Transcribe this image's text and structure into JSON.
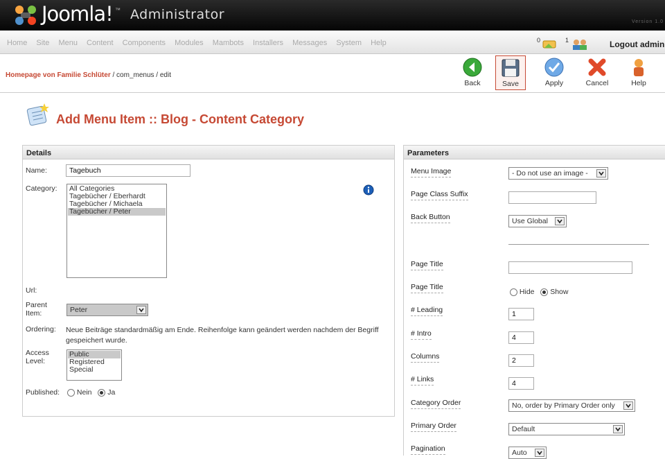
{
  "header": {
    "logo_word": "Joomla!",
    "logo_tm": "™",
    "logo_admin": "Administrator",
    "version": "Version 1.0"
  },
  "mainmenu": [
    "Home",
    "Site",
    "Menu",
    "Content",
    "Components",
    "Modules",
    "Mambots",
    "Installers",
    "Messages",
    "System",
    "Help"
  ],
  "status": {
    "messages_count": "0",
    "users_count": "1",
    "logout": "Logout admin"
  },
  "breadcrumb": {
    "home": "Homepage von Familie Schlüter",
    "path": " / com_menus / edit"
  },
  "toolbar": {
    "back": "Back",
    "save": "Save",
    "apply": "Apply",
    "cancel": "Cancel",
    "help": "Help"
  },
  "page": {
    "title": "Add Menu Item :: Blog - Content Category"
  },
  "details": {
    "heading": "Details",
    "name_label": "Name:",
    "name_value": "Tagebuch",
    "category_label": "Category:",
    "categories": [
      "All Categories",
      "Tagebücher / Eberhardt",
      "Tagebücher / Michaela",
      "Tagebücher / Peter"
    ],
    "url_label": "Url:",
    "parent_label": "Parent Item:",
    "parent_value": "Peter",
    "ordering_label": "Ordering:",
    "ordering_text": "Neue Beiträge standardmäßig am Ende. Reihenfolge kann geändert werden nachdem der Begriff gespeichert wurde.",
    "access_label": "Access Level:",
    "access_levels": [
      "Public",
      "Registered",
      "Special"
    ],
    "published_label": "Published:",
    "published_no": "Nein",
    "published_yes": "Ja"
  },
  "parameters": {
    "heading": "Parameters",
    "menu_image_label": "Menu Image",
    "menu_image_value": "- Do not use an image -",
    "page_class_label": "Page Class Suffix",
    "back_button_label": "Back Button",
    "back_button_value": "Use Global",
    "page_title_label": "Page Title",
    "page_title_label2": "Page Title",
    "hide": "Hide",
    "show": "Show",
    "leading_label": "# Leading",
    "leading_value": "1",
    "intro_label": "# Intro",
    "intro_value": "4",
    "columns_label": "Columns",
    "columns_value": "2",
    "links_label": "# Links",
    "links_value": "4",
    "category_order_label": "Category Order",
    "category_order_value": "No, order by Primary Order only",
    "primary_order_label": "Primary Order",
    "primary_order_value": "Default",
    "pagination_label": "Pagination",
    "pagination_value": "Auto"
  }
}
